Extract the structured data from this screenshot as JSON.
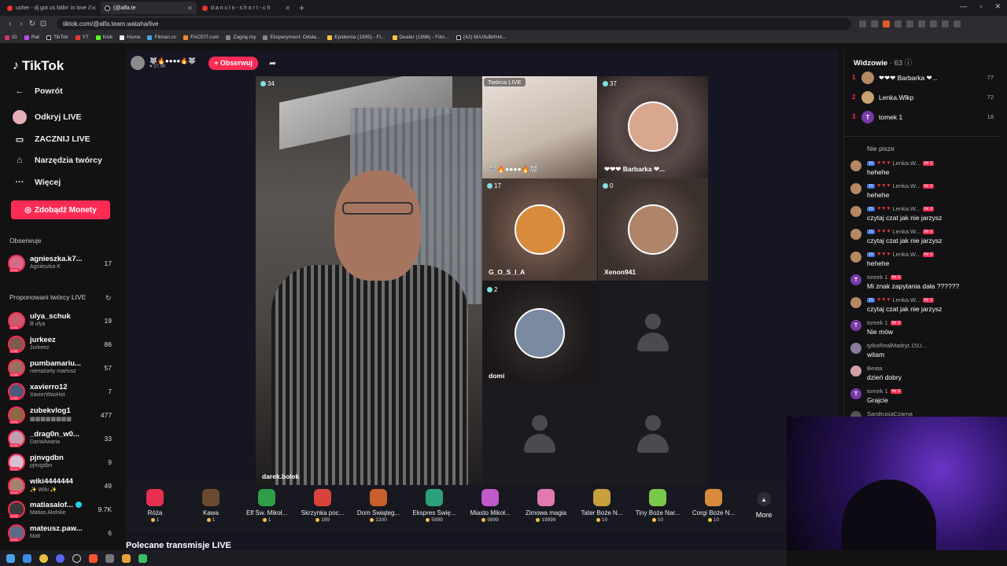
{
  "browser": {
    "tabs": [
      {
        "title": "usher - dj got us fallin' in love //",
        "active": false
      },
      {
        "title": "(@alfa.te",
        "active": true
      },
      {
        "title": "d a n c i n - s h o r t - c h",
        "active": false
      }
    ],
    "url": "tiktok.com/@alfa.team.wataha/live",
    "bookmarks": [
      "IG",
      "Rat",
      "TikTok",
      "YT",
      "Kick",
      "Home",
      "Filman.cc",
      "FACEIT.com",
      "Zagraj.my",
      "Eksperyment: Odsła...",
      "Epidemia (1995) - Fi...",
      "Dealer (1996) - Film...",
      "(42) МАЛЬВИНА..."
    ]
  },
  "sidebar": {
    "logo": "TikTok",
    "nav": [
      {
        "label": "Powrót",
        "icon": "back-arrow-icon"
      },
      {
        "label": "Odkryj LIVE",
        "icon": "live-avatar-icon"
      },
      {
        "label": "ZACZNIJ LIVE",
        "icon": "video-camera-icon"
      },
      {
        "label": "Narzędzia twórcy",
        "icon": "creator-tools-icon"
      },
      {
        "label": "Więcej",
        "icon": "more-dots-icon"
      }
    ],
    "coins_button": "Zdobądź Monety",
    "following_title": "Obserwuje",
    "following": [
      {
        "name": "agnieszka.k7...",
        "sub": "Agnieszka K",
        "count": "17"
      }
    ],
    "suggested_title": "Proponowani twórcy LIVE",
    "suggested": [
      {
        "name": "ulya_schuk",
        "sub": "lll ulya",
        "count": "19"
      },
      {
        "name": "jurkeez",
        "sub": "Jurkeez",
        "count": "86"
      },
      {
        "name": "pumbamariu...",
        "sub": "nienażarty mariusz",
        "count": "57"
      },
      {
        "name": "xavierro12",
        "sub": "XavierWasHot",
        "count": "7"
      },
      {
        "name": "zubekvlog1",
        "sub": "▩▩▩▩▩▩▩▩",
        "count": "477"
      },
      {
        "name": "_drag0n_w0...",
        "sub": "DariaAwaria",
        "count": "33"
      },
      {
        "name": "pjnvgdbn",
        "sub": "pjnvgdbn",
        "count": "9"
      },
      {
        "name": "wiki4444444",
        "sub": "✨ Wiki ✨",
        "count": "49"
      },
      {
        "name": "matiasalof...",
        "sub": "Matias Alofoke",
        "count": "9.7K",
        "verified": true
      },
      {
        "name": "mateusz.paw...",
        "sub": "Mati",
        "count": "6"
      }
    ]
  },
  "live": {
    "host_name": "🐺🔥●●●●🔥🐺",
    "host_likes": "♥ 27.9K",
    "follow_button": "+ Obserwuj",
    "tiles": [
      {
        "name": "darek.bolek",
        "viewers": "34"
      },
      {
        "name": "🐺🔥●●●●🔥🐺",
        "badge": "Twórca LIVE"
      },
      {
        "name": "❤❤❤ Barbarka ❤...",
        "viewers": "37"
      },
      {
        "name": "G_O_S_I_A",
        "viewers": "17"
      },
      {
        "name": "Xenon941",
        "viewers": "0"
      },
      {
        "name": "domi",
        "viewers": "2"
      }
    ],
    "gifts": [
      {
        "name": "Róża",
        "price": "1",
        "color": "#e6304e"
      },
      {
        "name": "Kawa",
        "price": "1",
        "color": "#6b4a32"
      },
      {
        "name": "Elf Św. Mikoł...",
        "price": "1",
        "color": "#2f9e46"
      },
      {
        "name": "Skrzynka poc...",
        "price": "199",
        "color": "#d8443c"
      },
      {
        "name": "Dom Świąteg...",
        "price": "2200",
        "color": "#c8602e"
      },
      {
        "name": "Ekspres Świę...",
        "price": "5999",
        "color": "#2aa17a"
      },
      {
        "name": "Miasto Mikoł...",
        "price": "9999",
        "color": "#c05ac8"
      },
      {
        "name": "Zimowa magia",
        "price": "19999",
        "color": "#e07ab0"
      },
      {
        "name": "Tater Boże N...",
        "price": "10",
        "color": "#c89f3a"
      },
      {
        "name": "Tiny Boże Nar...",
        "price": "10",
        "color": "#7ac84a"
      },
      {
        "name": "Corgi Boże N...",
        "price": "10",
        "color": "#d98a3a"
      }
    ],
    "more_label": "More",
    "recommended": "Polecane transmisje LIVE"
  },
  "chat": {
    "viewers_title": "Widzowie",
    "viewers_count": "· 63",
    "ranking": [
      {
        "pos": "1",
        "name": "❤❤❤ Barbarka ❤...",
        "points": "77"
      },
      {
        "pos": "2",
        "name": "Lenka.Wlkp",
        "points": "72"
      },
      {
        "pos": "3",
        "name": "tomek 1",
        "points": "18",
        "initial": "T"
      }
    ],
    "messages": [
      {
        "user": "Nie pisze",
        "text": "",
        "avatar": "none"
      },
      {
        "user": "Lenka.W...",
        "level": "15",
        "fan": "Nr 2",
        "text": "hehehe"
      },
      {
        "user": "Lenka.W...",
        "level": "15",
        "fan": "Nr 2",
        "text": "hehehe"
      },
      {
        "user": "Lenka.W...",
        "level": "15",
        "fan": "Nr 2",
        "text": "czytaj czat jak nie jarzysz"
      },
      {
        "user": "Lenka.W...",
        "level": "15",
        "fan": "Nr 2",
        "text": "czytaj czat jak nie jarzysz"
      },
      {
        "user": "Lenka.W...",
        "level": "15",
        "fan": "Nr 2",
        "text": "hehehe"
      },
      {
        "user": "tomek 1",
        "fan": "Nr 3",
        "text": "Mi znak zapytania dała ??????",
        "initial": "T"
      },
      {
        "user": "Lenka.W...",
        "level": "15",
        "fan": "Nr 2",
        "text": "czytaj czat jak nie jarzysz"
      },
      {
        "user": "tomek 1",
        "fan": "Nr 3",
        "text": "Nie mów",
        "initial": "T"
      },
      {
        "user": "tylkoRealMadryt.15U...",
        "text": "witam"
      },
      {
        "user": "Beata",
        "text": "dzień dobry"
      },
      {
        "user": "tomek 1",
        "fan": "Nr 3",
        "text": "Grajcie",
        "initial": "T"
      },
      {
        "user": "SandrusiaCzarna",
        "text": ""
      }
    ]
  }
}
